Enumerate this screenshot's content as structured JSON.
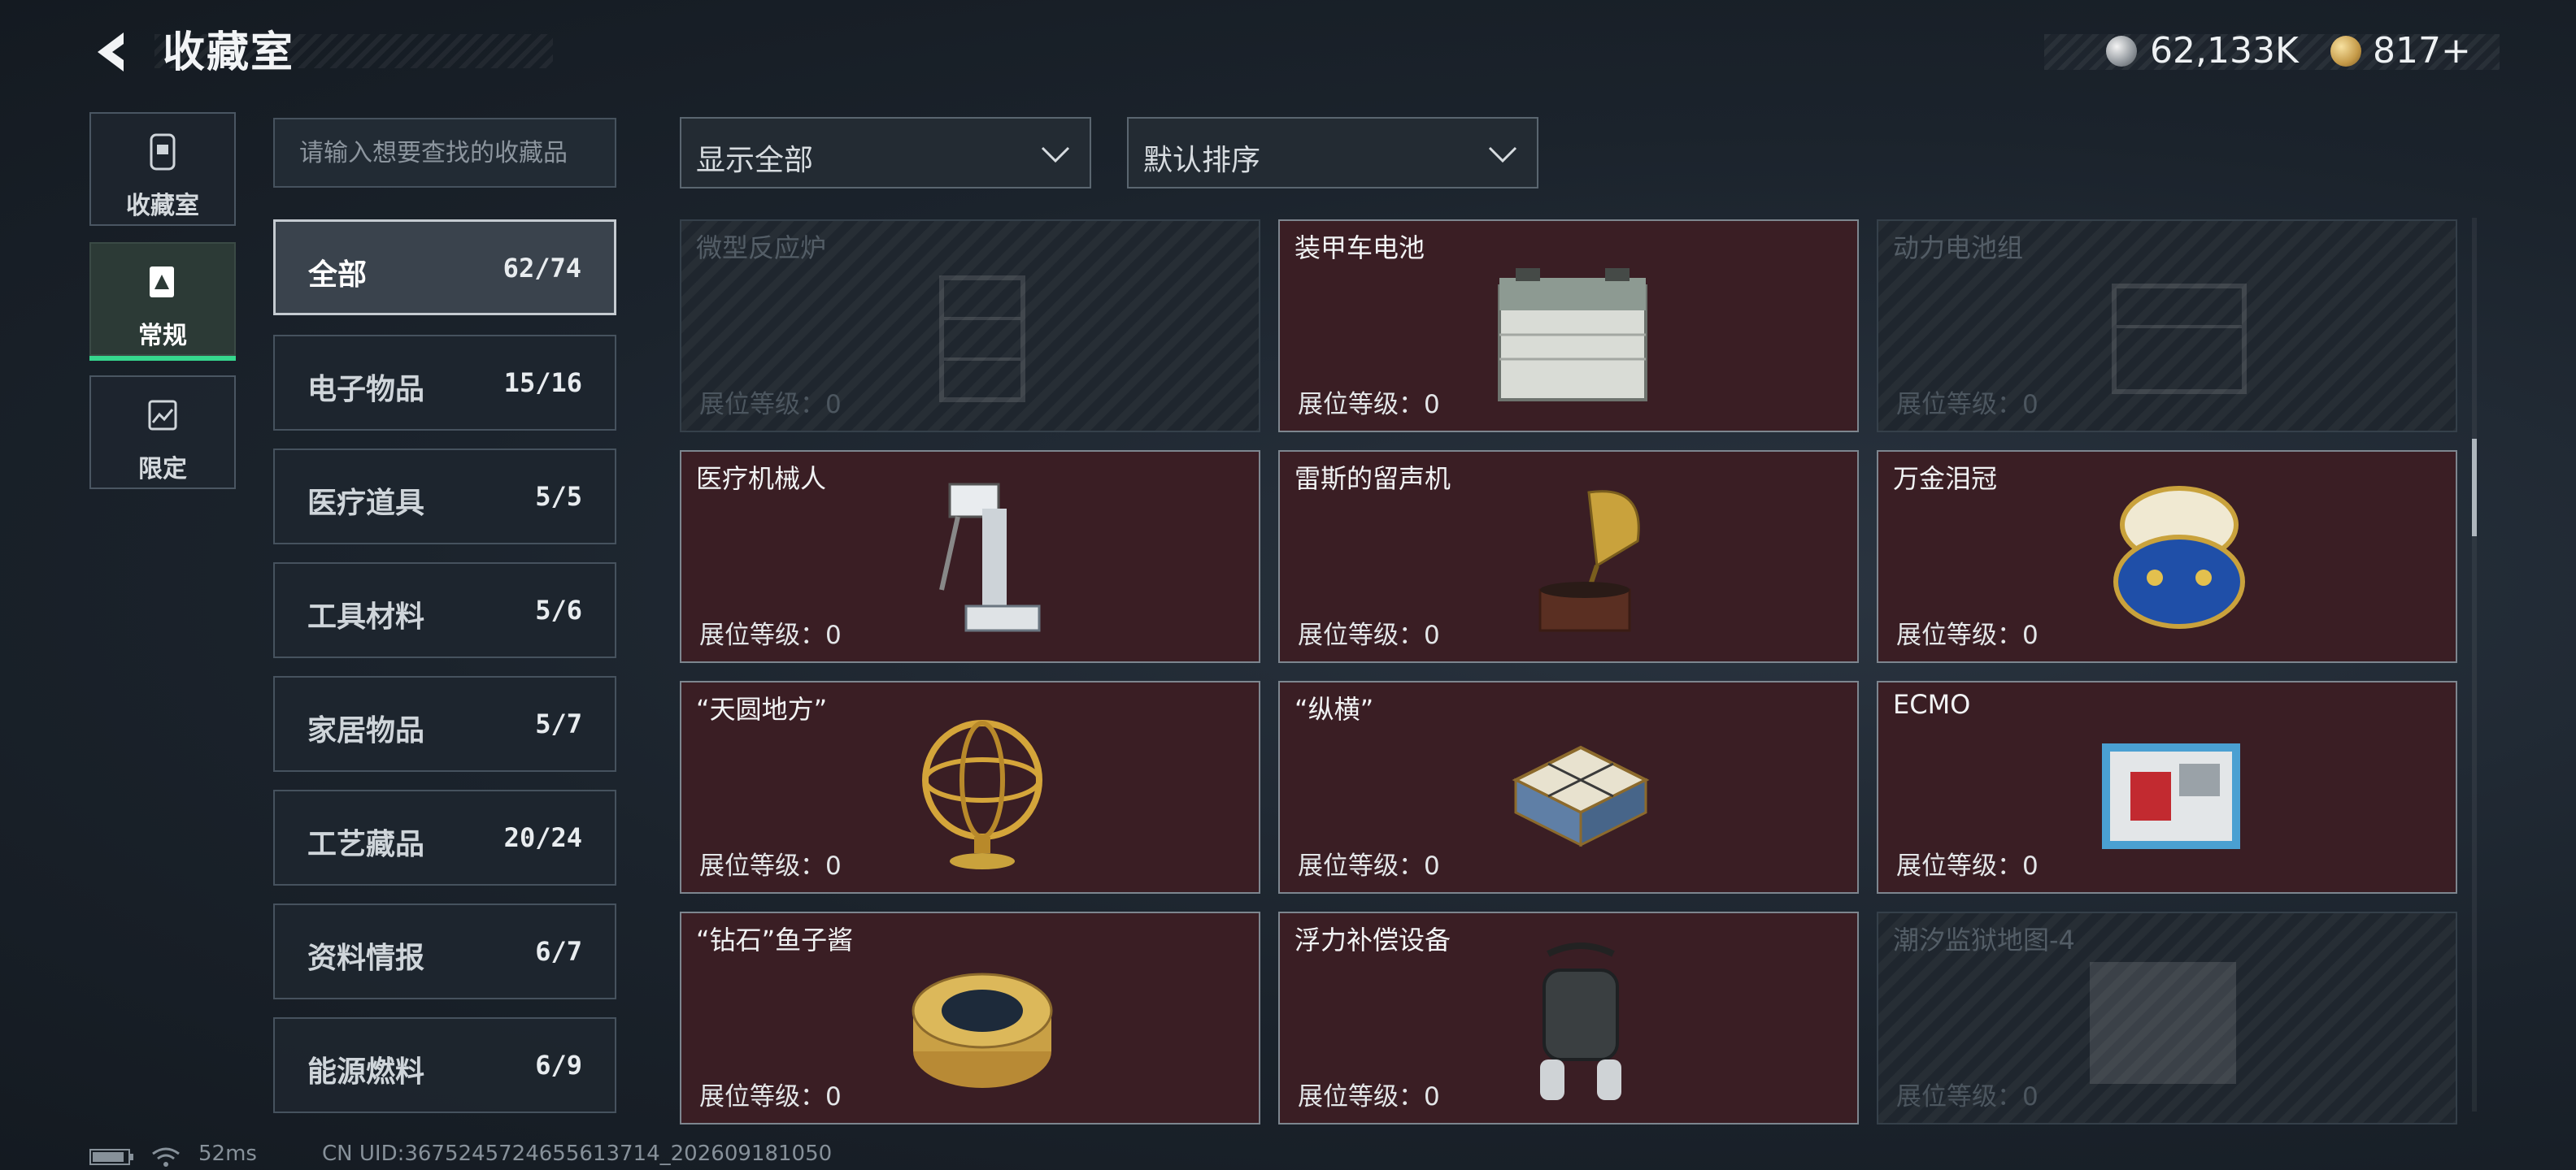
{
  "header": {
    "title": "收藏室",
    "currency_silver": "62,133K",
    "currency_gold": "817+"
  },
  "nav_tabs": [
    {
      "label": "收藏室",
      "icon": "collection-room-icon"
    },
    {
      "label": "常规",
      "icon": "regular-icon"
    },
    {
      "label": "限定",
      "icon": "limited-icon"
    }
  ],
  "search": {
    "placeholder": "请输入想要查找的收藏品"
  },
  "categories": [
    {
      "name": "全部",
      "count": "62/74"
    },
    {
      "name": "电子物品",
      "count": "15/16"
    },
    {
      "name": "医疗道具",
      "count": "5/5"
    },
    {
      "name": "工具材料",
      "count": "5/6"
    },
    {
      "name": "家居物品",
      "count": "5/7"
    },
    {
      "name": "工艺藏品",
      "count": "20/24"
    },
    {
      "name": "资料情报",
      "count": "6/7"
    },
    {
      "name": "能源燃料",
      "count": "6/9"
    }
  ],
  "filters": {
    "show": "显示全部",
    "sort": "默认排序"
  },
  "cards": [
    {
      "name": "微型反应炉",
      "level": "展位等级：0",
      "owned": false
    },
    {
      "name": "装甲车电池",
      "level": "展位等级：0",
      "owned": true
    },
    {
      "name": "动力电池组",
      "level": "展位等级：0",
      "owned": false
    },
    {
      "name": "医疗机械人",
      "level": "展位等级：0",
      "owned": true
    },
    {
      "name": "雷斯的留声机",
      "level": "展位等级：0",
      "owned": true
    },
    {
      "name": "万金泪冠",
      "level": "展位等级：0",
      "owned": true
    },
    {
      "name": "“天圆地方”",
      "level": "展位等级：0",
      "owned": true
    },
    {
      "name": "“纵横”",
      "level": "展位等级：0",
      "owned": true
    },
    {
      "name": "ECMO",
      "level": "展位等级：0",
      "owned": true
    },
    {
      "name": "“钻石”鱼子酱",
      "level": "展位等级：0",
      "owned": true
    },
    {
      "name": "浮力补偿设备",
      "level": "展位等级：0",
      "owned": true
    },
    {
      "name": "潮汐监狱地图-4",
      "level": "展位等级：0",
      "owned": false
    }
  ],
  "status": {
    "ping": "52ms",
    "uid": "CN UID:3675245724655613714_202609181050"
  }
}
